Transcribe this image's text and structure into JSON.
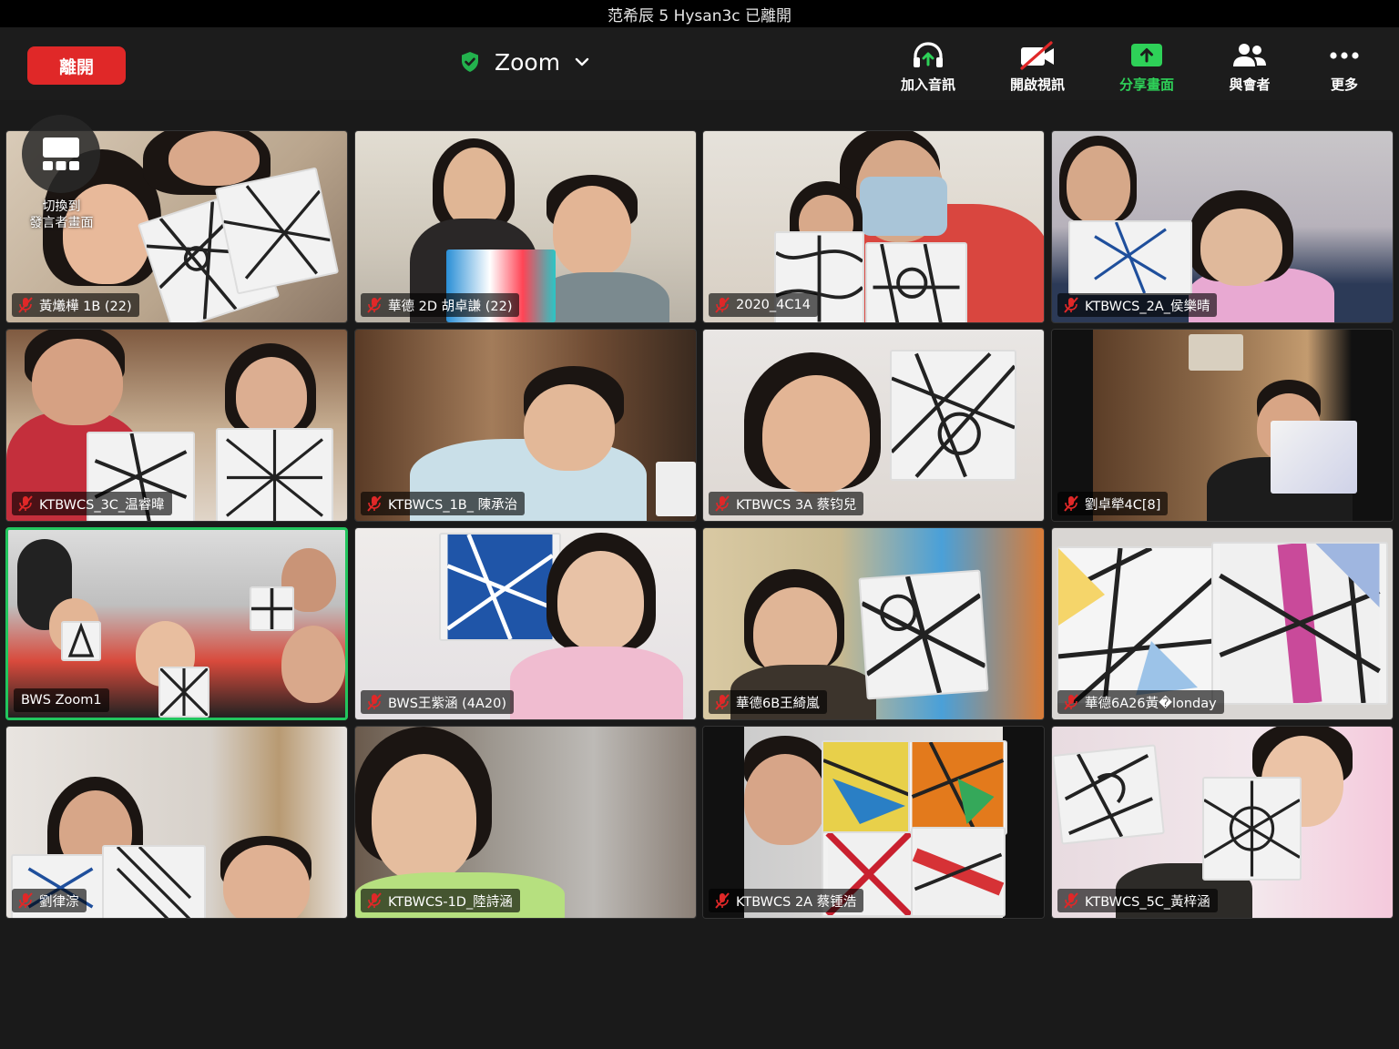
{
  "status_bar": {
    "notice": "范希辰 5 Hysan3c 已離開"
  },
  "toolbar": {
    "leave_label": "離開",
    "meeting_title": "Zoom",
    "shield_icon": "green-shield-check",
    "buttons": [
      {
        "label": "加入音訊",
        "icon": "headphones-icon"
      },
      {
        "label": "開啟視訊",
        "icon": "video-off-icon"
      },
      {
        "label": "分享畫面",
        "icon": "share-screen-icon",
        "color": "#2ed158"
      },
      {
        "label": "與會者",
        "icon": "participants-icon"
      },
      {
        "label": "更多",
        "icon": "more-icon"
      }
    ]
  },
  "speaker_switch": {
    "label": "切換到\n發言者畫面",
    "icon": "speaker-view-icon"
  },
  "gallery": {
    "tiles": [
      {
        "name": "黃爔樺 1B (22)",
        "muted": true
      },
      {
        "name": "華德 2D 胡卓謙 (22)",
        "muted": true
      },
      {
        "name": "2020_4C14",
        "muted": true
      },
      {
        "name": "KTBWCS_2A_侯樂晴",
        "muted": true
      },
      {
        "name": "KTBWCS_3C_温睿暐",
        "muted": true
      },
      {
        "name": "KTBWCS_1B_ 陳承治",
        "muted": true
      },
      {
        "name": "KTBWCS 3A 蔡钧兒",
        "muted": true
      },
      {
        "name": "劉卓犖4C[8]",
        "muted": true
      },
      {
        "name": "BWS Zoom1",
        "muted": false,
        "active_speaker": true
      },
      {
        "name": "BWS王紫涵  (4A20)",
        "muted": true
      },
      {
        "name": "華德6B王綺嵐",
        "muted": true
      },
      {
        "name": "華德6A26黃�londay",
        "muted": true
      },
      {
        "name": "劉律淙",
        "muted": true
      },
      {
        "name": "KTBWCS-1D_陸詩涵",
        "muted": true
      },
      {
        "name": "KTBWCS 2A 蔡锺浩",
        "muted": true
      },
      {
        "name": "KTBWCS_5C_黃梓涵",
        "muted": true
      }
    ]
  },
  "colors": {
    "leave": "#e02828",
    "active_border": "#22c55e",
    "share": "#2ed158",
    "mute": "#e02828"
  }
}
